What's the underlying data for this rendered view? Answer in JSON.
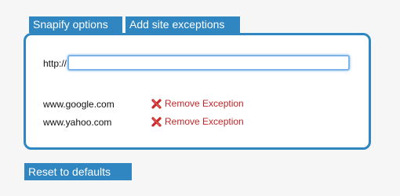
{
  "tabs": [
    {
      "label": "Snapify options"
    },
    {
      "label": "Add site exceptions"
    }
  ],
  "url_field": {
    "prefix_label": "http://",
    "value": "",
    "placeholder": ""
  },
  "exceptions": [
    {
      "site": "www.google.com",
      "remove_label": "Remove Exception"
    },
    {
      "site": "www.yahoo.com",
      "remove_label": "Remove Exception"
    }
  ],
  "reset_button": {
    "label": "Reset to defaults"
  },
  "colors": {
    "accent": "#2f86c0",
    "remove_text": "#c0282a",
    "remove_icon": "#cc2a2a",
    "input_focus": "#7fb4e8"
  },
  "icons": {
    "remove": "red-x-icon"
  }
}
